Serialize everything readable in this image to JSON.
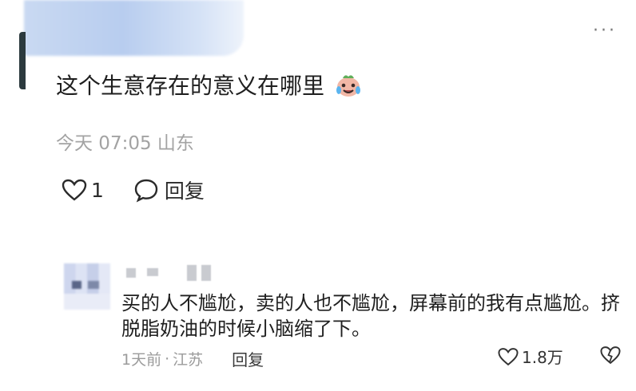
{
  "top_comment": {
    "text": "这个生意存在的意义在哪里",
    "emoji": "crying-laughing-emoji",
    "time": "今天 07:05",
    "location": "山东",
    "like_count": "1",
    "reply_label": "回复",
    "more_label": "···"
  },
  "reply_comment": {
    "text": "买的人不尴尬，卖的人也不尴尬，屏幕前的我有点尴尬。挤脱脂奶油的时候小脑缩了下。",
    "time": "1天前",
    "separator": "·",
    "location": "江苏",
    "reply_label": "回复",
    "like_count": "1.8万"
  }
}
